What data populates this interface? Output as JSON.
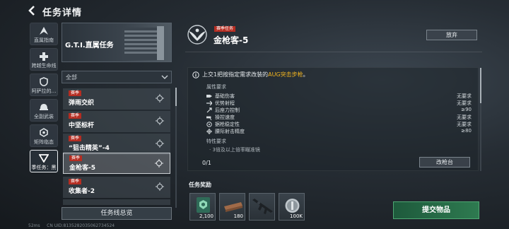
{
  "header": {
    "title": "任务详情"
  },
  "rail": [
    {
      "label": "直属指南",
      "icon": "rank-chevron-icon"
    },
    {
      "label": "跨越生命线",
      "icon": "medic-cross-icon"
    },
    {
      "label": "阿萨拉的…",
      "icon": "shield-icon"
    },
    {
      "label": "全副武装",
      "icon": "helmet-icon"
    },
    {
      "label": "矩阵临态",
      "icon": "hexagon-icon"
    },
    {
      "label": "季任务：黑",
      "icon": "triangle-badge-icon"
    }
  ],
  "banner": {
    "title": "G.T.I.直属任务"
  },
  "filter": {
    "label": "全部"
  },
  "tasks": [
    {
      "tag": "赛季",
      "name": "弹雨交织"
    },
    {
      "tag": "赛季",
      "name": "中坚标杆"
    },
    {
      "tag": "赛季",
      "name": "“狙击精英”-4"
    },
    {
      "tag": "赛季",
      "name": "金枪客-5"
    },
    {
      "tag": "赛季",
      "name": "收集者-2"
    }
  ],
  "overview_button": "任务线总览",
  "detail": {
    "tag": "赛季任务",
    "title": "金枪客-5",
    "abandon": "放弃",
    "objective_prefix": "上交1把按指定需求改装的",
    "objective_highlight": "AUG突击步枪",
    "objective_suffix": "。",
    "attr_heading": "属性要求",
    "attributes": [
      {
        "name": "基础伤害",
        "value": "无要求",
        "icon": "bullet-icon"
      },
      {
        "name": "优势射程",
        "value": "无要求",
        "icon": "range-icon"
      },
      {
        "name": "后座力控制",
        "value": "≥90",
        "icon": "recoil-icon"
      },
      {
        "name": "操控速度",
        "value": "无要求",
        "icon": "handling-icon"
      },
      {
        "name": "据枪稳定性",
        "value": "无要求",
        "icon": "stability-icon"
      },
      {
        "name": "腰际射击精度",
        "value": "≥80",
        "icon": "crosshair-icon"
      }
    ],
    "feature_heading": "特性要求",
    "feature_item": "· 3倍及以上倍率瞄准镜",
    "progress": "0/1",
    "workbench": "改枪台"
  },
  "rewards": {
    "title": "任务奖励",
    "items": [
      {
        "qty": "2,100",
        "icon": "exp-card-icon"
      },
      {
        "qty": "180",
        "icon": "wood-plank-icon"
      },
      {
        "qty": "",
        "icon": "rifle-icon"
      },
      {
        "qty": "100K",
        "icon": "coin-icon"
      }
    ]
  },
  "submit": "提交物品",
  "status": {
    "ping": "52ms",
    "uid": "CN UID:8135282035062734524"
  },
  "colors": {
    "highlight": "#f1b420",
    "tag_red": "#b52d22",
    "submit_green": "#2e7a50"
  }
}
